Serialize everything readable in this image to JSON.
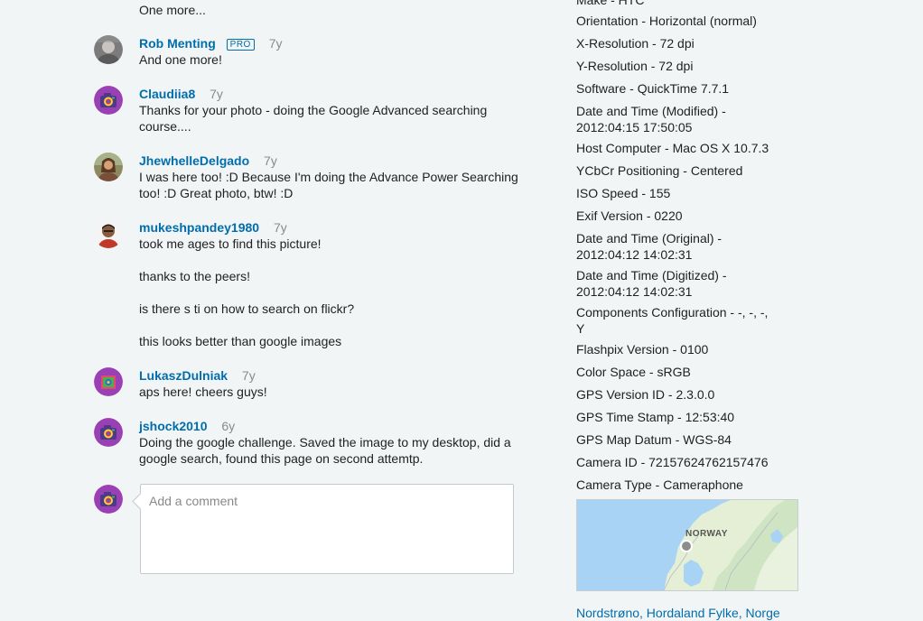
{
  "comments": [
    {
      "username": "",
      "age": "",
      "text": [
        "One more..."
      ]
    },
    {
      "username": "Rob Menting",
      "pro": "PRO",
      "age": "7y",
      "text": [
        "And one more!"
      ]
    },
    {
      "username": "Claudiia8",
      "age": "7y",
      "text": [
        "Thanks for your photo - doing the Google Advanced searching course...."
      ]
    },
    {
      "username": "JhewhelleDelgado",
      "age": "7y",
      "text": [
        "I was here too! :D Because I'm doing the Advance Power Searching too! :D Great photo, btw! :D"
      ]
    },
    {
      "username": "mukeshpandey1980",
      "age": "7y",
      "text": [
        "took me ages to find this picture!",
        "thanks to the peers!",
        "is there s ti on how to search on flickr?",
        "this looks better than google images"
      ]
    },
    {
      "username": "LukaszDulniak",
      "age": "7y",
      "text": [
        "aps here! cheers guys!"
      ]
    },
    {
      "username": "jshock2010",
      "age": "6y",
      "text": [
        "Doing the google challenge. Saved the image to my desktop, did a google search, found this page on second attemtp."
      ]
    }
  ],
  "add_comment": {
    "placeholder": "Add a comment"
  },
  "exif": [
    "Make - HTC",
    "Orientation - Horizontal (normal)",
    "X-Resolution - 72 dpi",
    "Y-Resolution - 72 dpi",
    "Software - QuickTime 7.7.1",
    "Date and Time (Modified) - 2012:04:15 17:50:05",
    "Host Computer - Mac OS X 10.7.3",
    "YCbCr Positioning - Centered",
    "ISO Speed - 155",
    "Exif Version - 0220",
    "Date and Time (Original) - 2012:04:12 14:02:31",
    "Date and Time (Digitized) - 2012:04:12 14:02:31",
    "Components Configuration - -, -, -, Y",
    "Flashpix Version - 0100",
    "Color Space - sRGB",
    "GPS Version ID - 2.3.0.0",
    "GPS Time Stamp - 12:53:40",
    "GPS Map Datum - WGS-84",
    "Camera ID - 72157624762157476",
    "Camera Type - Cameraphone"
  ],
  "map": {
    "label": "NORWAY"
  },
  "location": "Nordstrøno, Hordaland Fylke, Norge",
  "colors": {
    "link": "#006dac",
    "background": "#f2f5f6",
    "text": "#212124",
    "muted": "#898989"
  },
  "icons": {
    "buddy": "camera-buddy-icon"
  }
}
